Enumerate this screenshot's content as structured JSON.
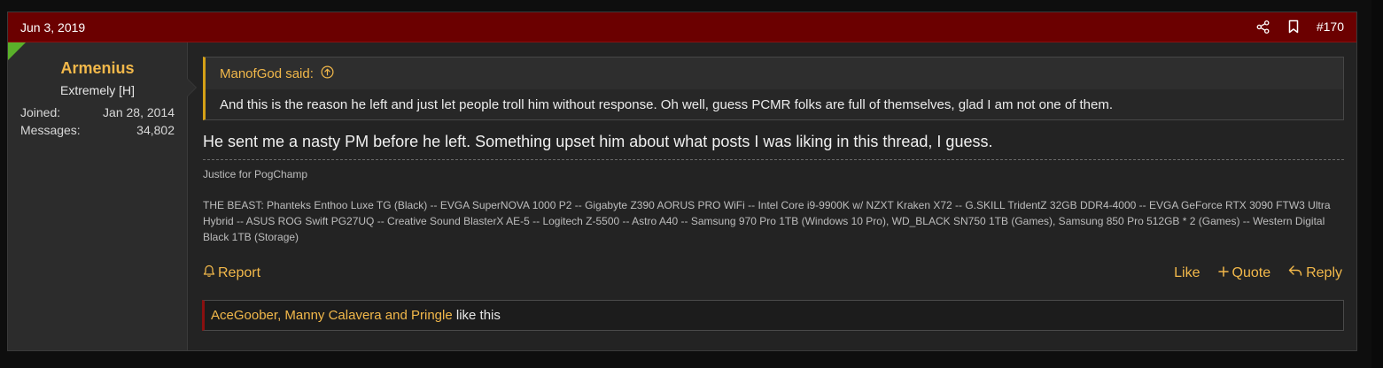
{
  "post": {
    "date": "Jun 3, 2019",
    "number": "#170",
    "icons": {
      "share": "share-icon",
      "bookmark": "bookmark-icon"
    }
  },
  "user": {
    "name": "Armenius",
    "title": "Extremely [H]",
    "joined_label": "Joined:",
    "joined_value": "Jan 28, 2014",
    "messages_label": "Messages:",
    "messages_value": "34,802"
  },
  "quote": {
    "author_said": "ManofGod said:",
    "text": "And this is the reason he left and just let people troll him without response. Oh well, guess PCMR folks are full of themselves, glad I am not one of them."
  },
  "message": {
    "text": "He sent me a nasty PM before he left. Something upset him about what posts I was liking in this thread, I guess."
  },
  "signature": {
    "line1": "Justice for PogChamp",
    "block": "THE BEAST: Phanteks Enthoo Luxe TG (Black) -- EVGA SuperNOVA 1000 P2 -- Gigabyte Z390 AORUS PRO WiFi -- Intel Core i9-9900K w/ NZXT Kraken X72 -- G.SKILL TridentZ 32GB DDR4-4000 -- EVGA GeForce RTX 3090 FTW3 Ultra Hybrid -- ASUS ROG Swift PG27UQ -- Creative Sound BlasterX AE-5 -- Logitech Z-5500 -- Astro A40 -- Samsung 970 Pro 1TB (Windows 10 Pro), WD_BLACK SN750 1TB (Games), Samsung 850 Pro 512GB * 2 (Games) -- Western Digital Black 1TB (Storage)"
  },
  "actions": {
    "report": "Report",
    "like": "Like",
    "quote": "Quote",
    "reply": "Reply"
  },
  "likes": {
    "names": [
      "AceGoober",
      "Manny Calavera",
      "Pringle"
    ],
    "joiner1": ", ",
    "joiner2": " and ",
    "suffix": " like this"
  },
  "colors": {
    "header_bg": "#6b0000",
    "accent": "#f2b84a",
    "quote_border": "#d4a017",
    "online_marker": "#5ab02a"
  }
}
